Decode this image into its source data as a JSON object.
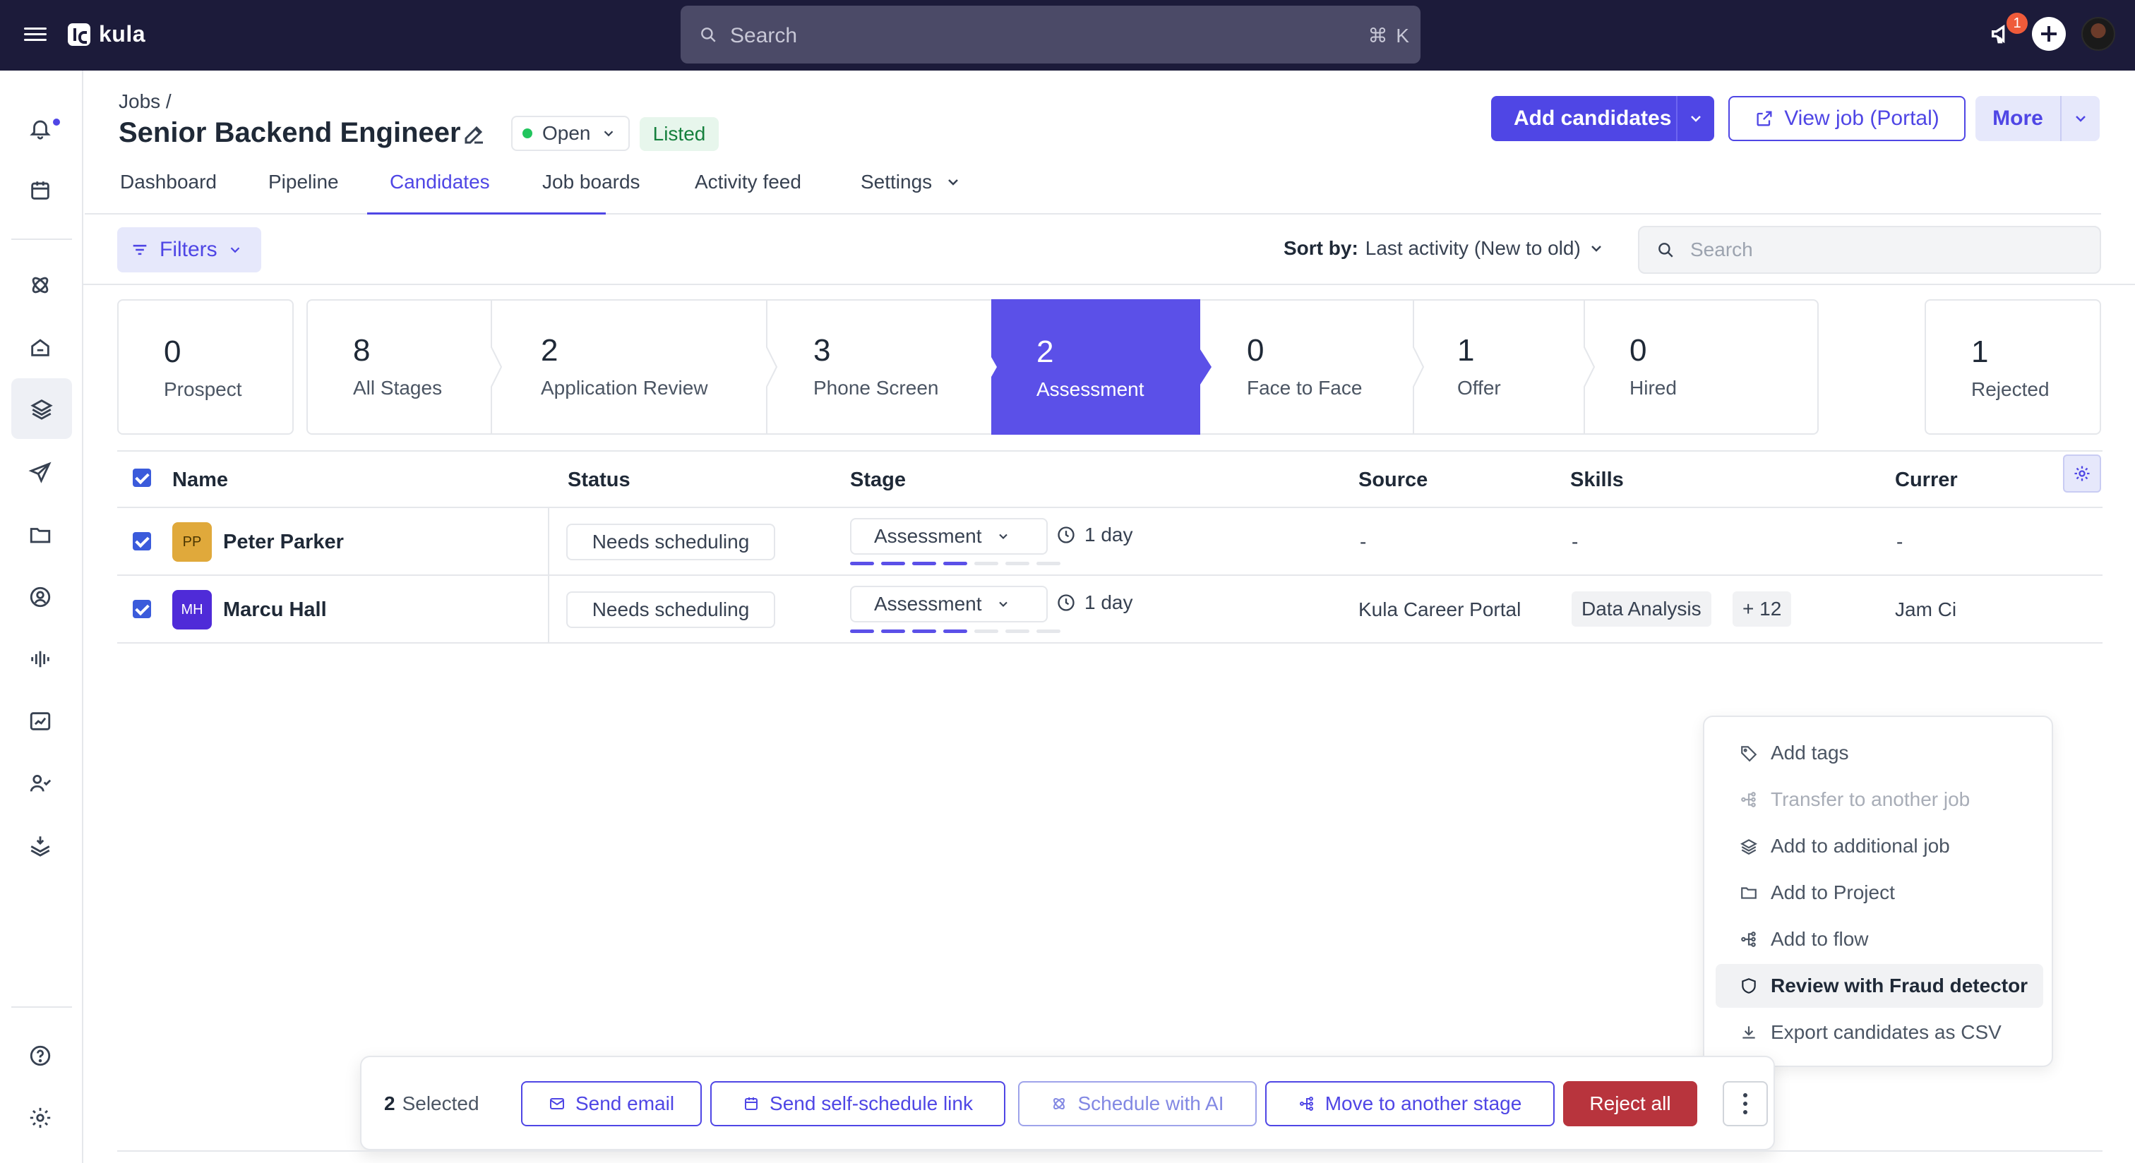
{
  "app": {
    "logo_text": "kula"
  },
  "top_search": {
    "placeholder": "Search",
    "shortcut": "⌘ K"
  },
  "notifications": {
    "count": "1"
  },
  "breadcrumb": "Jobs /",
  "job": {
    "title": "Senior Backend Engineer",
    "status": "Open",
    "visibility": "Listed"
  },
  "header_actions": {
    "add_candidates": "Add candidates",
    "view_job": "View job (Portal)",
    "more": "More"
  },
  "tabs": [
    {
      "label": "Dashboard"
    },
    {
      "label": "Pipeline"
    },
    {
      "label": "Candidates",
      "active": true
    },
    {
      "label": "Job boards"
    },
    {
      "label": "Activity feed"
    },
    {
      "label": "Settings"
    }
  ],
  "filters": {
    "label": "Filters"
  },
  "sort": {
    "prefix": "Sort by:",
    "value": "Last activity (New to old)"
  },
  "list_search": {
    "placeholder": "Search"
  },
  "stages": [
    {
      "count": "0",
      "label": "Prospect"
    },
    {
      "count": "8",
      "label": "All Stages"
    },
    {
      "count": "2",
      "label": "Application Review"
    },
    {
      "count": "3",
      "label": "Phone Screen"
    },
    {
      "count": "2",
      "label": "Assessment",
      "active": true
    },
    {
      "count": "0",
      "label": "Face to Face"
    },
    {
      "count": "1",
      "label": "Offer"
    },
    {
      "count": "0",
      "label": "Hired"
    },
    {
      "count": "1",
      "label": "Rejected"
    }
  ],
  "table": {
    "headers": {
      "name": "Name",
      "status": "Status",
      "stage": "Stage",
      "source": "Source",
      "skills": "Skills",
      "current": "Currer"
    },
    "rows": [
      {
        "initials": "PP",
        "avatar_color": "#e0a93b",
        "avatar_text_color": "#4a3500",
        "name": "Peter Parker",
        "status": "Needs scheduling",
        "stage": "Assessment",
        "progress_done": 4,
        "progress_total": 7,
        "duration": "1 day",
        "source": "-",
        "skill": "-",
        "skill_more": "",
        "current": "-"
      },
      {
        "initials": "MH",
        "avatar_color": "#4f2bd8",
        "avatar_text_color": "#ffffff",
        "name": "Marcu Hall",
        "status": "Needs scheduling",
        "stage": "Assessment",
        "progress_done": 4,
        "progress_total": 7,
        "duration": "1 day",
        "source": "Kula Career Portal",
        "skill": "Data Analysis",
        "skill_more": "+ 12",
        "current": "Jam Ci"
      }
    ]
  },
  "context_menu": [
    {
      "label": "Add tags",
      "icon": "tag-icon"
    },
    {
      "label": "Transfer to another job",
      "icon": "flow-icon",
      "disabled": true
    },
    {
      "label": "Add to additional job",
      "icon": "layers-icon"
    },
    {
      "label": "Add to Project",
      "icon": "folder-icon"
    },
    {
      "label": "Add to flow",
      "icon": "flow-icon"
    },
    {
      "label": "Review with Fraud detector",
      "icon": "shield-icon",
      "hover": true
    },
    {
      "label": "Export candidates as CSV",
      "icon": "download-icon"
    }
  ],
  "bulk_bar": {
    "selected_count": "2",
    "selected_label": "Selected",
    "send_email": "Send email",
    "self_schedule": "Send self-schedule link",
    "schedule_ai": "Schedule with AI",
    "move_stage": "Move to another stage",
    "reject_all": "Reject all"
  },
  "colors": {
    "primary": "#4f46e5",
    "topbar": "#1c1b3a",
    "danger": "#b8343d",
    "open_dot": "#22c55e"
  }
}
